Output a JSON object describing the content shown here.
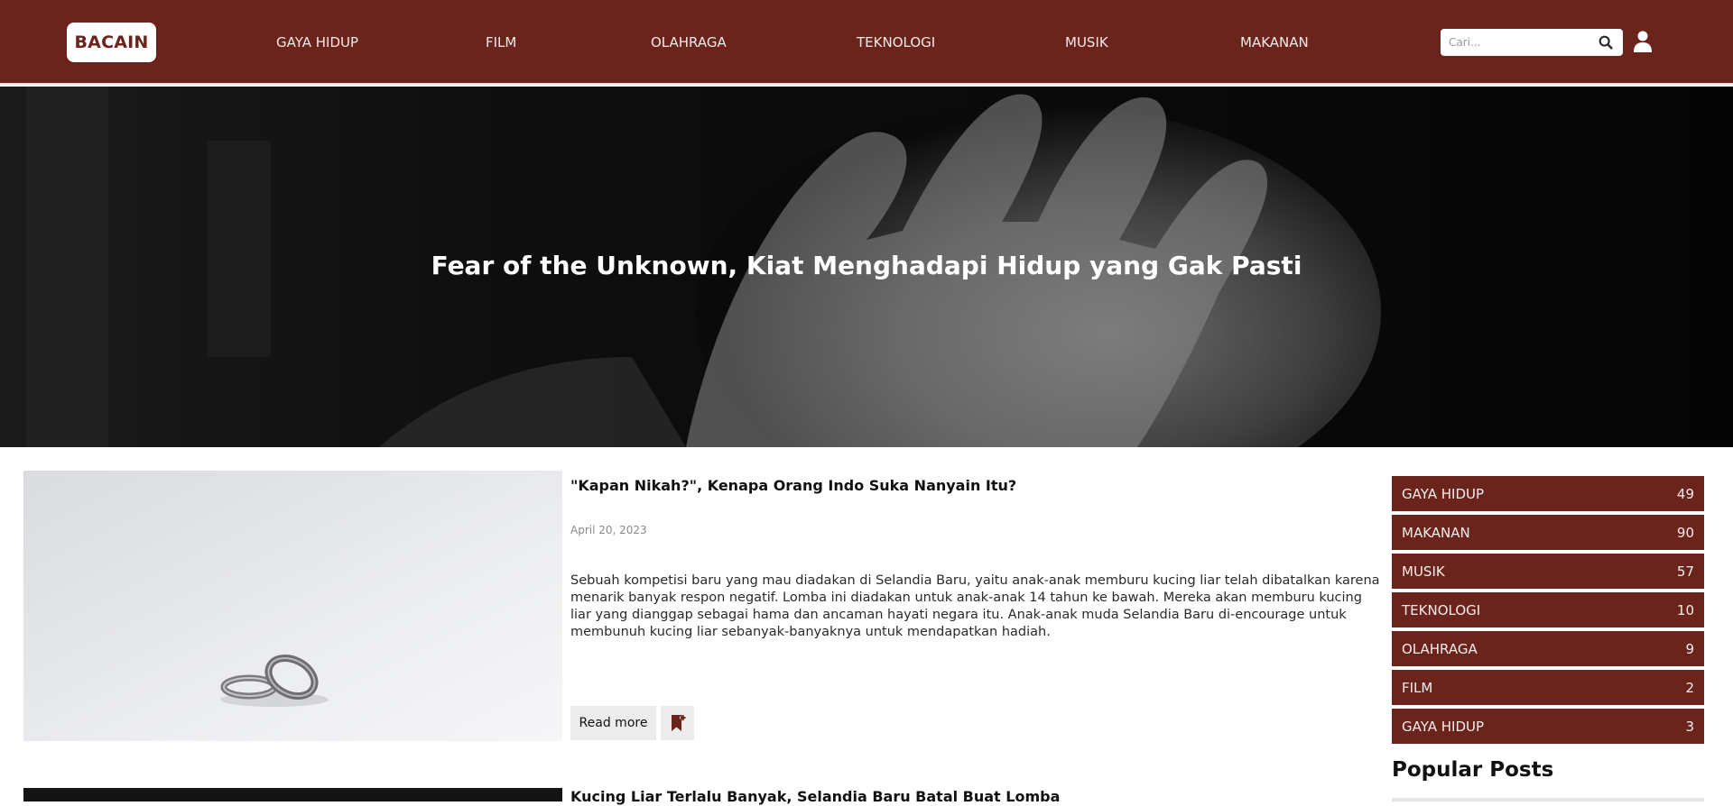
{
  "header": {
    "logo": "BACAIN",
    "nav": [
      "GAYA HIDUP",
      "FILM",
      "OLAHRAGA",
      "TEKNOLOGI",
      "MUSIK",
      "MAKANAN"
    ],
    "search_placeholder": "Cari...",
    "search_icon": "magnifier",
    "user_icon": "person"
  },
  "hero": {
    "title": "Fear of the Unknown, Kiat Menghadapi Hidup yang Gak Pasti"
  },
  "posts": [
    {
      "title": "\"Kapan Nikah?\", Kenapa Orang Indo Suka Nanyain Itu?",
      "date": "April 20, 2023",
      "excerpt": "Sebuah kompetisi baru yang mau diadakan di Selandia Baru, yaitu anak-anak memburu kucing liar telah dibatalkan karena menarik banyak respon negatif. Lomba ini diadakan untuk anak-anak 14 tahun ke bawah. Mereka akan memburu kucing liar yang dianggap sebagai hama dan ancaman hayati negara itu. Anak-anak muda Selandia Baru di-encourage untuk membunuh kucing liar sebanyak-banyaknya untuk mendapatkan hadiah.",
      "read_more": "Read more",
      "bookmark_icon": "bookmark-plus"
    },
    {
      "title": "Kucing Liar Terlalu Banyak, Selandia Baru Batal Buat Lomba"
    }
  ],
  "sidebar": {
    "categories": [
      {
        "name": "GAYA HIDUP",
        "count": "49"
      },
      {
        "name": "MAKANAN",
        "count": "90"
      },
      {
        "name": "MUSIK",
        "count": "57"
      },
      {
        "name": "TEKNOLOGI",
        "count": "10"
      },
      {
        "name": "OLAHRAGA",
        "count": "9"
      },
      {
        "name": "FILM",
        "count": "2"
      },
      {
        "name": "GAYA HIDUP",
        "count": "3"
      }
    ],
    "popular_title": "Popular Posts"
  },
  "colors": {
    "brand": "#6b241c",
    "header_text": "#f3e9e7",
    "button_bg": "#ececec"
  }
}
